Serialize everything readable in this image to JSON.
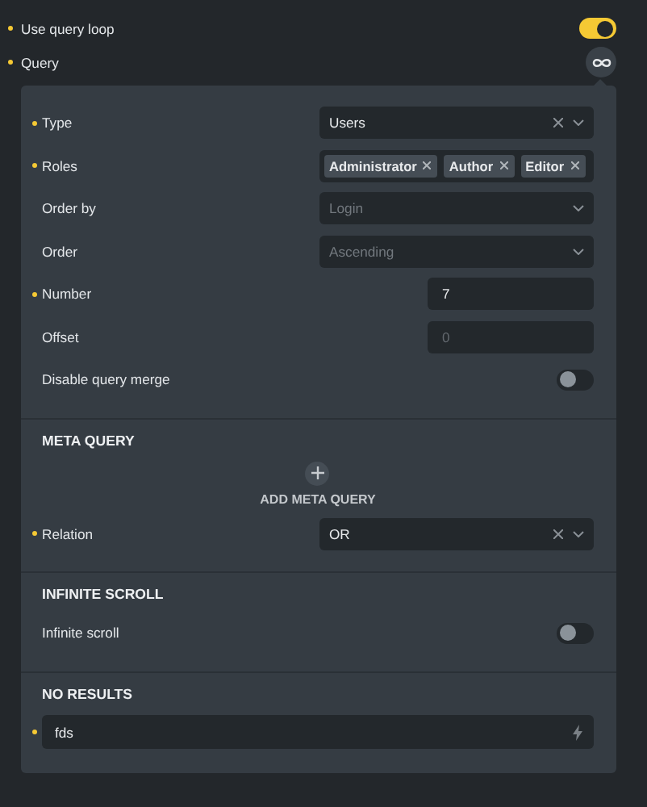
{
  "top": [
    {
      "label": "Use query loop",
      "modified": true,
      "kind": "toggle",
      "on": true
    },
    {
      "label": "Query",
      "modified": true,
      "kind": "loop-button"
    }
  ],
  "sections": [
    {
      "rows": [
        {
          "label": "Type",
          "modified": true,
          "kind": "select",
          "value": "Users",
          "clearable": true
        },
        {
          "label": "Roles",
          "modified": true,
          "kind": "tags",
          "tags": [
            "Administrator",
            "Author",
            "Editor"
          ]
        },
        {
          "label": "Order by",
          "modified": false,
          "kind": "select",
          "placeholder": "Login",
          "clearable": false
        },
        {
          "label": "Order",
          "modified": false,
          "kind": "select",
          "placeholder": "Ascending",
          "clearable": false
        },
        {
          "label": "Number",
          "modified": true,
          "kind": "number",
          "value": "7"
        },
        {
          "label": "Offset",
          "modified": false,
          "kind": "number",
          "placeholder": "0"
        },
        {
          "label": "Disable query merge",
          "modified": false,
          "kind": "toggle",
          "on": false
        }
      ]
    },
    {
      "title": "META QUERY",
      "add_button": "ADD META QUERY",
      "rows": [
        {
          "label": "Relation",
          "modified": true,
          "kind": "select",
          "value": "OR",
          "clearable": true
        }
      ]
    },
    {
      "title": "INFINITE SCROLL",
      "rows": [
        {
          "label": "Infinite scroll",
          "modified": false,
          "kind": "toggle",
          "on": false
        }
      ]
    },
    {
      "title": "NO RESULTS",
      "rows": [
        {
          "modified": true,
          "kind": "text",
          "value": "fds"
        }
      ]
    }
  ]
}
